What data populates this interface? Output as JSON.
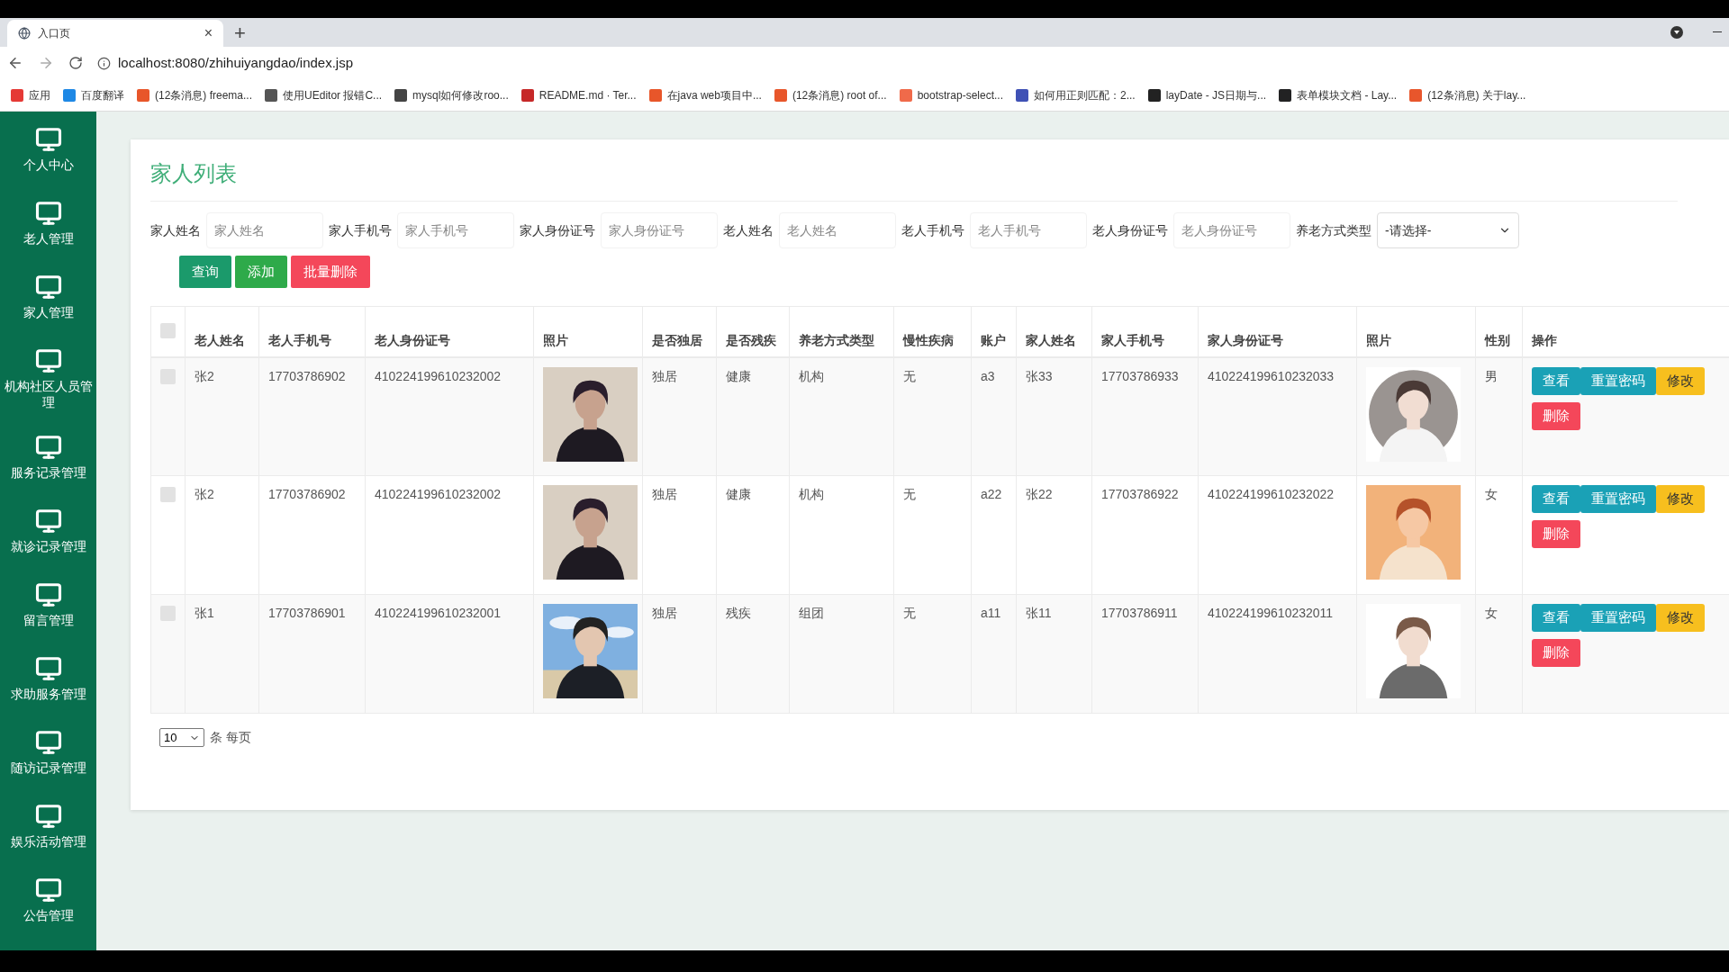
{
  "browser": {
    "tab_title": "入口页",
    "tab_close": "×",
    "new_tab": "+",
    "url": "localhost:8080/zhihuiyangdao/index.jsp",
    "bookmarks": [
      {
        "label": "应用",
        "color": "#e53935"
      },
      {
        "label": "百度翻译",
        "color": "#1e88e5"
      },
      {
        "label": "(12条消息) freema...",
        "color": "#e8562a"
      },
      {
        "label": "使用UEditor 报错C...",
        "color": "#555555"
      },
      {
        "label": "mysql如何修改roo...",
        "color": "#444444"
      },
      {
        "label": "README.md · Ter...",
        "color": "#c62828"
      },
      {
        "label": "在java web项目中...",
        "color": "#e8562a"
      },
      {
        "label": "(12条消息) root of...",
        "color": "#e8562b"
      },
      {
        "label": "bootstrap-select...",
        "color": "#f06a4a"
      },
      {
        "label": "如何用正则匹配：2...",
        "color": "#3f51b5"
      },
      {
        "label": "layDate - JS日期与...",
        "color": "#222222"
      },
      {
        "label": "表单模块文档 - Lay...",
        "color": "#222223"
      },
      {
        "label": "(12条消息) 关于lay...",
        "color": "#e8562c"
      }
    ]
  },
  "sidebar": {
    "items": [
      {
        "label": "个人中心"
      },
      {
        "label": "老人管理"
      },
      {
        "label": "家人管理"
      },
      {
        "label": "机构社区人员管理"
      },
      {
        "label": "服务记录管理"
      },
      {
        "label": "就诊记录管理"
      },
      {
        "label": "留言管理"
      },
      {
        "label": "求助服务管理"
      },
      {
        "label": "随访记录管理"
      },
      {
        "label": "娱乐活动管理"
      },
      {
        "label": "公告管理"
      }
    ]
  },
  "page": {
    "title": "家人列表",
    "filters": [
      {
        "kind": "text",
        "label": "家人姓名",
        "placeholder": "家人姓名"
      },
      {
        "kind": "text",
        "label": "家人手机号",
        "placeholder": "家人手机号"
      },
      {
        "kind": "text",
        "label": "家人身份证号",
        "placeholder": "家人身份证号"
      },
      {
        "kind": "text",
        "label": "老人姓名",
        "placeholder": "老人姓名"
      },
      {
        "kind": "text",
        "label": "老人手机号",
        "placeholder": "老人手机号"
      },
      {
        "kind": "text",
        "label": "老人身份证号",
        "placeholder": "老人身份证号"
      },
      {
        "kind": "select",
        "label": "养老方式类型",
        "value": "-请选择-"
      }
    ],
    "buttons": [
      {
        "label": "查询",
        "kind": "query"
      },
      {
        "label": "添加",
        "kind": "add"
      },
      {
        "label": "批量删除",
        "kind": "delete"
      }
    ],
    "table": {
      "select_all": {
        "checked": false
      },
      "columns": [
        "老人姓名",
        "老人手机号",
        "老人身份证号",
        "照片",
        "是否独居",
        "是否残疾",
        "养老方式类型",
        "慢性疾病",
        "账户",
        "家人姓名",
        "家人手机号",
        "家人身份证号",
        "照片",
        "性别",
        "操作"
      ],
      "rows": [
        {
          "checked": false,
          "cells": [
            {
              "kind": "text",
              "text": "张2"
            },
            {
              "kind": "text",
              "text": "17703786902"
            },
            {
              "kind": "text",
              "text": "410224199610232002"
            },
            {
              "kind": "picture"
            },
            {
              "kind": "text",
              "text": "独居"
            },
            {
              "kind": "text",
              "text": "健康"
            },
            {
              "kind": "text",
              "text": "机构"
            },
            {
              "kind": "text",
              "text": "无"
            },
            {
              "kind": "text",
              "text": "a3"
            },
            {
              "kind": "text",
              "text": "张33"
            },
            {
              "kind": "text",
              "text": "17703786933"
            },
            {
              "kind": "text",
              "text": "410224199610232033"
            },
            {
              "kind": "picture"
            },
            {
              "kind": "text",
              "text": "男"
            }
          ],
          "actions": [
            {
              "label": "查看",
              "kind": "view"
            },
            {
              "label": "重置密码",
              "kind": "reset"
            },
            {
              "label": "修改",
              "kind": "edit"
            },
            {
              "label": "删除",
              "kind": "delete"
            }
          ]
        },
        {
          "checked": false,
          "cells": [
            {
              "kind": "text",
              "text": "张2"
            },
            {
              "kind": "text",
              "text": "17703786902"
            },
            {
              "kind": "text",
              "text": "410224199610232002"
            },
            {
              "kind": "picture"
            },
            {
              "kind": "text",
              "text": "独居"
            },
            {
              "kind": "text",
              "text": "健康"
            },
            {
              "kind": "text",
              "text": "机构"
            },
            {
              "kind": "text",
              "text": "无"
            },
            {
              "kind": "text",
              "text": "a22"
            },
            {
              "kind": "text",
              "text": "张22"
            },
            {
              "kind": "text",
              "text": "17703786922"
            },
            {
              "kind": "text",
              "text": "410224199610232022"
            },
            {
              "kind": "picture"
            },
            {
              "kind": "text",
              "text": "女"
            }
          ],
          "actions": [
            {
              "label": "查看",
              "kind": "view"
            },
            {
              "label": "重置密码",
              "kind": "reset"
            },
            {
              "label": "修改",
              "kind": "edit"
            },
            {
              "label": "删除",
              "kind": "delete"
            }
          ]
        },
        {
          "checked": false,
          "cells": [
            {
              "kind": "text",
              "text": "张1"
            },
            {
              "kind": "text",
              "text": "17703786901"
            },
            {
              "kind": "text",
              "text": "410224199610232001"
            },
            {
              "kind": "picture"
            },
            {
              "kind": "text",
              "text": "独居"
            },
            {
              "kind": "text",
              "text": "残疾"
            },
            {
              "kind": "text",
              "text": "组团"
            },
            {
              "kind": "text",
              "text": "无"
            },
            {
              "kind": "text",
              "text": "a11"
            },
            {
              "kind": "text",
              "text": "张11"
            },
            {
              "kind": "text",
              "text": "17703786911"
            },
            {
              "kind": "text",
              "text": "410224199610232011"
            },
            {
              "kind": "picture"
            },
            {
              "kind": "text",
              "text": "女"
            }
          ],
          "actions": [
            {
              "label": "查看",
              "kind": "view"
            },
            {
              "label": "重置密码",
              "kind": "reset"
            },
            {
              "label": "修改",
              "kind": "edit"
            },
            {
              "label": "删除",
              "kind": "delete"
            }
          ]
        }
      ]
    },
    "pagination": {
      "page_size": "10",
      "label": "条 每页"
    }
  }
}
